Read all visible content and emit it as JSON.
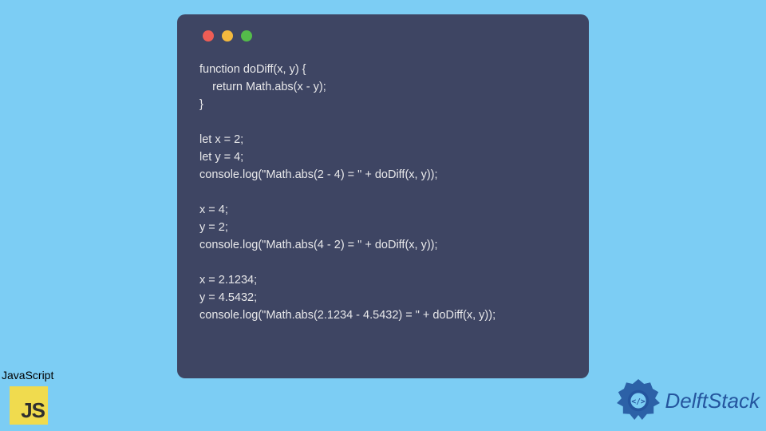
{
  "code": {
    "lines": [
      "function doDiff(x, y) {",
      "    return Math.abs(x - y);",
      "}",
      "",
      "let x = 2;",
      "let y = 4;",
      "console.log(\"Math.abs(2 - 4) = \" + doDiff(x, y));",
      "",
      "x = 4;",
      "y = 2;",
      "console.log(\"Math.abs(4 - 2) = \" + doDiff(x, y));",
      "",
      "x = 2.1234;",
      "y = 4.5432;",
      "console.log(\"Math.abs(2.1234 - 4.5432) = \" + doDiff(x, y));"
    ]
  },
  "jsLabel": "JavaScript",
  "jsLogoText": "JS",
  "brandName": "DelftStack",
  "colors": {
    "background": "#7ccdf4",
    "codeWindow": "#3e4563",
    "codeText": "#e8e8ea",
    "jsLogoBg": "#f0db4e",
    "brandColor": "#24559e"
  }
}
